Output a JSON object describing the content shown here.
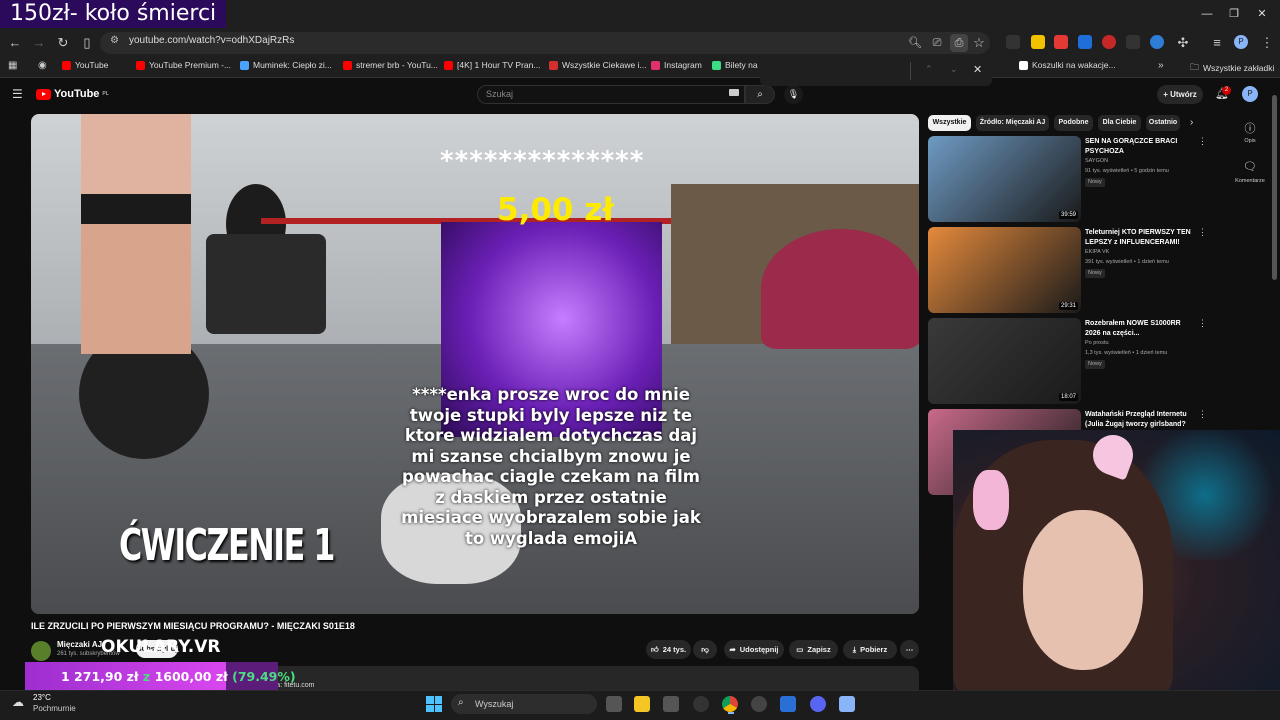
{
  "overlay": {
    "stream_title": "150zł- koło śmierci",
    "donation_stars": "**************",
    "donation_amount": "5,00 zł",
    "donation_message": "****enka prosze wroc do mnie twoje stupki byly lepsze niz te ktore widzialem dotychczas daj mi szanse chcialbym znowu je powachac ciagle czekam na film z daskiem przez ostatnie miesiace wyobrazalem sobie jak to wyglada emojiA",
    "exercise_caption": "ĆWICZENIE 1",
    "okulary": "OKULARY.VR",
    "goal_current": "1 271,90 zł",
    "goal_sep": "z",
    "goal_target": "1600,00 zł",
    "goal_percent": "(79.49%)",
    "goal_fraction": 0.7949
  },
  "browser": {
    "url": "youtube.com/watch?v=odhXDajRzRs",
    "bookmarks": [
      {
        "label": "YouTube",
        "color": "#ff0000"
      },
      {
        "label": "YouTube Premium -...",
        "color": "#ff0000"
      },
      {
        "label": "Muminek: Ciepło zi...",
        "color": "#4aa3ff"
      },
      {
        "label": "stremer brb - YouTu...",
        "color": "#ff0000"
      },
      {
        "label": "[4K] 1 Hour TV Pran...",
        "color": "#ff0000"
      },
      {
        "label": "Wszystkie Ciekawe i...",
        "color": "#d32f2f"
      },
      {
        "label": "Instagram",
        "color": "#e1306c"
      },
      {
        "label": "Bilety na I",
        "color": "#3ddc84"
      }
    ],
    "bookmarks_right": [
      {
        "label": "Koszulki na wakacje...",
        "color": "#ffffff"
      },
      {
        "label": "Wszystkie zakładki",
        "color": "#cccccc"
      }
    ]
  },
  "youtube": {
    "logo": "YouTube",
    "logo_region": "PL",
    "search_placeholder": "Szukaj",
    "create_label": "Utwórz",
    "notification_count": "2",
    "avatar_letter": "P",
    "video_title": "ILE ZRZUCILI PO PIERWSZYM MIESIĄCU PROGRAMU? - MIĘCZAKI S01E18",
    "channel_name": "Mięczaki AJ",
    "channel_subs": "261 tys. subskrybentów",
    "subscribe_label": "Subskrybuj",
    "likes": "24 tys.",
    "share_label": "Udostępnij",
    "save_label": "Zapisz",
    "download_label": "Pobierz",
    "description_snippet": "...zadzwoniła na: fitetu.com",
    "chips": [
      "Wszystkie",
      "Źródło: Mięczaki AJ",
      "Podobne",
      "Dla Ciebie",
      "Ostatnio"
    ],
    "recommendations": [
      {
        "title": "SEN NA GORĄCZCE BRACI PSYCHOZA",
        "channel": "SAYGON",
        "meta": "91 tys. wyświetleń • 5 godzin temu",
        "badge": "Nowy",
        "duration": "39:59",
        "color": "#6e9bc4"
      },
      {
        "title": "Teleturniej KTO PIERWSZY TEN LEPSZY z INFLUENCERAMI!",
        "channel": "EKIPA VK",
        "meta": "391 tys. wyświetleń • 1 dzień temu",
        "badge": "Nowy",
        "duration": "29:31",
        "color": "#e58a3c"
      },
      {
        "title": "Rozebrałem NOWE S1000RR 2026 na części...",
        "channel": "Po prostu",
        "meta": "1,3 tys. wyświetleń • 1 dzień temu",
        "badge": "Nowy",
        "duration": "18:07",
        "color": "#3a3a3a"
      },
      {
        "title": "Watahański Przegląd Internetu (Julia Żugaj tworzy girlsband? ...",
        "channel": "",
        "meta": "",
        "badge": "",
        "duration": "",
        "color": "#c86a8a"
      }
    ],
    "rail": [
      {
        "label": "Opis",
        "icon": "info-icon"
      },
      {
        "label": "Komentarze",
        "icon": "comment-icon"
      }
    ]
  },
  "taskbar": {
    "temperature": "23°C",
    "weather": "Pochmurnie",
    "search_label": "Wyszukaj"
  }
}
